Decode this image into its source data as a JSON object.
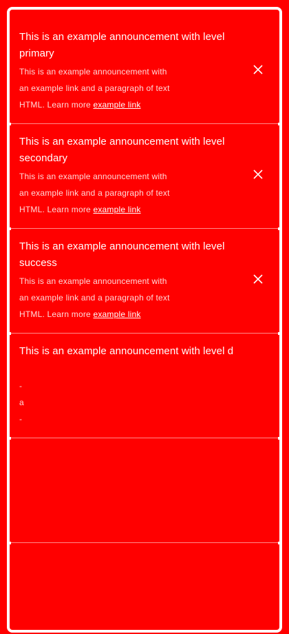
{
  "announcements": [
    {
      "title": "This is an example announcement with level primary",
      "body_lines": [
        "This is an example announcement with",
        "an example link and a paragraph of text",
        "HTML. Learn more"
      ],
      "link": "example link",
      "dismissible": true
    },
    {
      "title": "This is an example announcement with level secondary",
      "body_lines": [
        "This is an example announcement with",
        "an example link and a paragraph of text",
        "HTML. Learn more"
      ],
      "link": "example link",
      "dismissible": true
    },
    {
      "title": "This is an example announcement with level success",
      "body_lines": [
        "This is an example announcement with",
        "an example link and a paragraph of text",
        "HTML. Learn more"
      ],
      "link": "example link",
      "dismissible": true
    },
    {
      "title": "This is an example announcement with level d",
      "body_lines": [
        "-",
        "a",
        "-"
      ],
      "link": "",
      "dismissible": false
    }
  ],
  "colors": {
    "background": "#ff0000",
    "text": "#ffffff"
  },
  "icons": {
    "close": "close-icon"
  }
}
